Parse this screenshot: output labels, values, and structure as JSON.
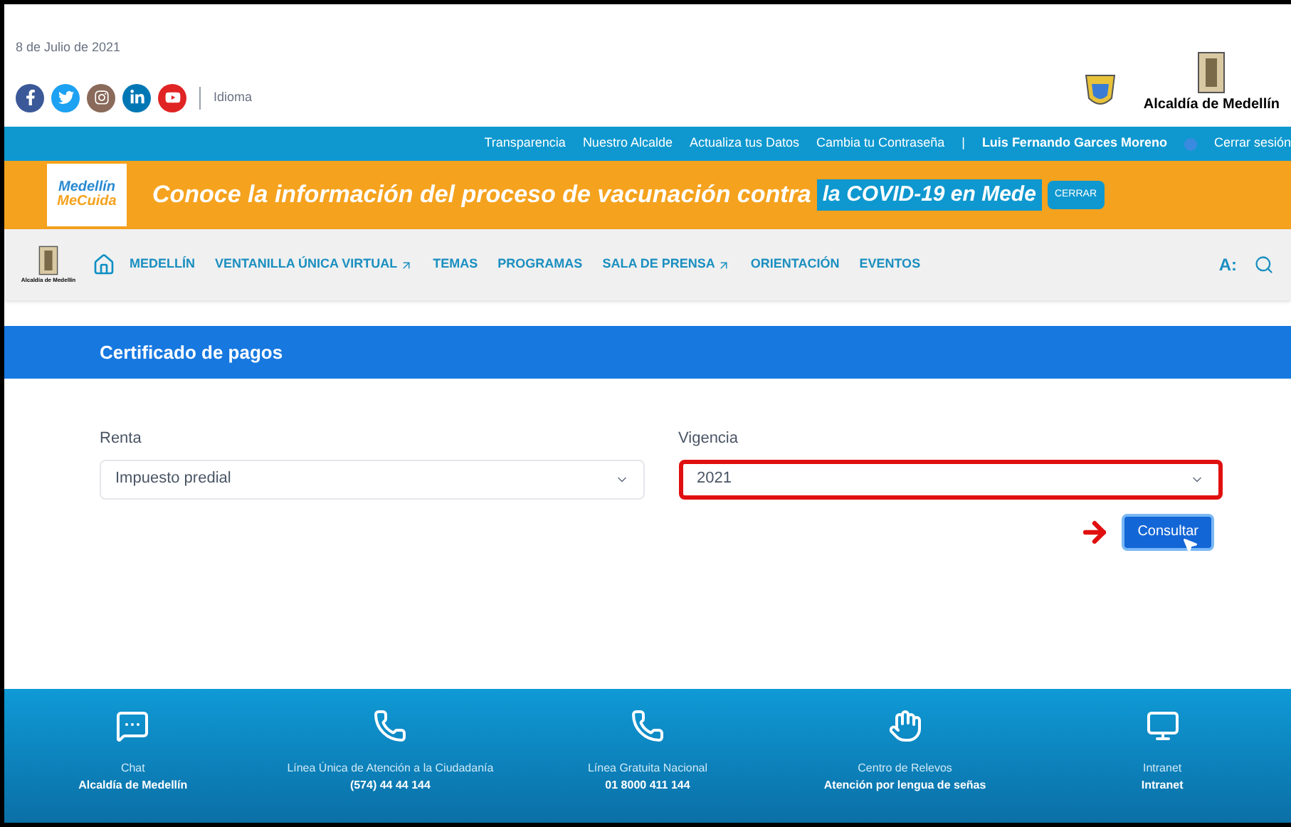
{
  "header": {
    "date": "8 de Julio de 2021",
    "social": [
      {
        "kind": "facebook"
      },
      {
        "kind": "twitter"
      },
      {
        "kind": "instagram"
      },
      {
        "kind": "linkedin"
      },
      {
        "kind": "youtube"
      }
    ],
    "language": "Idioma",
    "logo_caption": "Alcaldía de Medellín"
  },
  "top_bar": {
    "links": [
      "Transparencia",
      "Nuestro Alcalde",
      "Actualiza tus Datos",
      "Cambia tu Contraseña"
    ],
    "separator": "|",
    "user": "Luis Fernando Garces Moreno",
    "logout": "Cerrar sesión"
  },
  "banner": {
    "logo_line1": "Medellín",
    "logo_line2": "MeCuida",
    "text": "Conoce la información del proceso de vacunación contra",
    "highlight": "la COVID-19 en Mede",
    "close": "CERRAR"
  },
  "nav": {
    "logo_caption": "Alcaldía de Medellín",
    "items": [
      {
        "label": "MEDELLÍN",
        "external": false
      },
      {
        "label": "VENTANILLA ÚNICA VIRTUAL",
        "external": true
      },
      {
        "label": "TEMAS",
        "external": false
      },
      {
        "label": "PROGRAMAS",
        "external": false
      },
      {
        "label": "SALA DE PRENSA",
        "external": true
      },
      {
        "label": "ORIENTACIÓN",
        "external": false
      },
      {
        "label": "EVENTOS",
        "external": false
      }
    ],
    "font_size": "A:"
  },
  "page_title": "Certificado de pagos",
  "form": {
    "fields": [
      {
        "label": "Renta",
        "value": "Impuesto predial",
        "highlighted": false
      },
      {
        "label": "Vigencia",
        "value": "2021",
        "highlighted": true
      }
    ],
    "button": "Consultar"
  },
  "footer": [
    {
      "kind": "chat",
      "title": "Chat",
      "detail": "Alcaldía de Medellín"
    },
    {
      "kind": "phone",
      "title": "Línea Única de Atención a la Ciudadanía",
      "detail": "(574) 44 44 144"
    },
    {
      "kind": "phone",
      "title": "Línea Gratuita Nacional",
      "detail": "01 8000 411 144"
    },
    {
      "kind": "hands",
      "title": "Centro de Relevos",
      "detail": "Atención por lengua de señas"
    },
    {
      "kind": "monitor",
      "title": "Intranet",
      "detail": "Intranet"
    }
  ]
}
